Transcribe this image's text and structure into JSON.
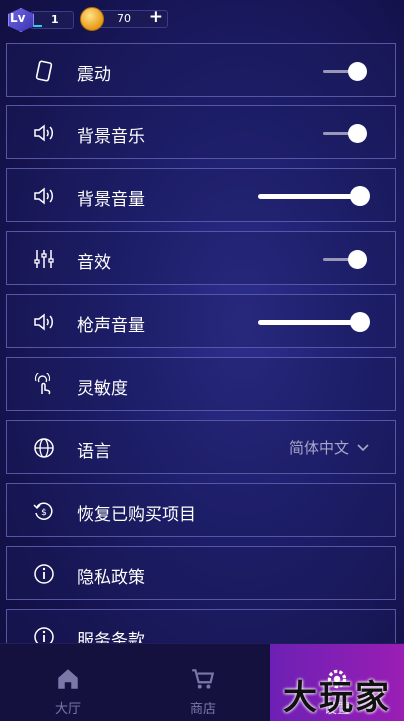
{
  "header": {
    "level_prefix": "Lv",
    "level_value": "1",
    "level_progress_fraction": 0.25,
    "coins": "70",
    "add_symbol": "+"
  },
  "settings": [
    {
      "label": "震动",
      "control": "toggle",
      "state": "on",
      "icon": "phone-vibrate-icon"
    },
    {
      "label": "背景音乐",
      "control": "toggle",
      "state": "on",
      "icon": "speaker-icon"
    },
    {
      "label": "背景音量",
      "control": "slider",
      "value_fraction": 1.0,
      "icon": "speaker-icon"
    },
    {
      "label": "音效",
      "control": "toggle",
      "state": "on",
      "icon": "equalizer-icon"
    },
    {
      "label": "枪声音量",
      "control": "slider",
      "value_fraction": 1.0,
      "icon": "speaker-icon"
    },
    {
      "label": "灵敏度",
      "control": "none",
      "icon": "touch-gesture-icon"
    },
    {
      "label": "语言",
      "control": "select",
      "value": "简体中文",
      "icon": "globe-icon"
    },
    {
      "label": "恢复已购买项目",
      "control": "none",
      "icon": "restore-purchase-icon"
    },
    {
      "label": "隐私政策",
      "control": "none",
      "icon": "info-icon"
    },
    {
      "label": "服务条款",
      "control": "none",
      "icon": "info-icon"
    }
  ],
  "tabs": [
    {
      "label": "大厅",
      "icon": "home-icon"
    },
    {
      "label": "商店",
      "icon": "cart-icon"
    },
    {
      "label": "设置",
      "icon": "settings-icon",
      "active": true
    }
  ],
  "watermark": "大玩家",
  "colors": {
    "toggle_knob": "#ffffff",
    "row_border": "#5756a2",
    "active_tab": "#8a1fb5",
    "level_progress": "#27d3e8",
    "coin": "#f2b127"
  }
}
